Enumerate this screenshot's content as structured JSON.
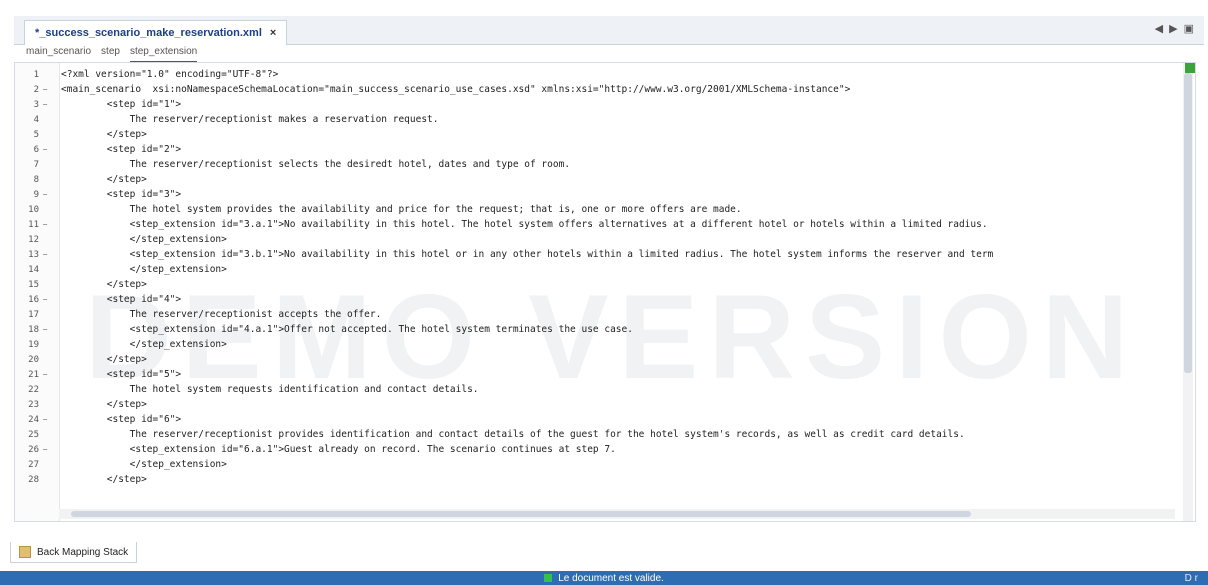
{
  "tab": {
    "title": "*_success_scenario_make_reservation.xml",
    "close": "×"
  },
  "tab_controls": [
    "◀",
    "▶",
    "▣"
  ],
  "breadcrumb": [
    "main_scenario",
    "step",
    "step_extension"
  ],
  "editor": {
    "lines": [
      {
        "n": "1",
        "code": "<?xml version=\"1.0\" encoding=\"UTF-8\"?>"
      },
      {
        "n": "2",
        "code": "<main_scenario  xsi:noNamespaceSchemaLocation=\"main_success_scenario_use_cases.xsd\" xmlns:xsi=\"http://www.w3.org/2001/XMLSchema-instance\">"
      },
      {
        "n": "3",
        "code": "        <step id=\"1\">"
      },
      {
        "n": "4",
        "code": "            The reserver/receptionist makes a reservation request."
      },
      {
        "n": "5",
        "code": "        </step>"
      },
      {
        "n": "6",
        "code": "        <step id=\"2\">"
      },
      {
        "n": "7",
        "code": "            The reserver/receptionist selects the desiredt hotel, dates and type of room."
      },
      {
        "n": "8",
        "code": "        </step>"
      },
      {
        "n": "9",
        "code": "        <step id=\"3\">"
      },
      {
        "n": "10",
        "code": "            The hotel system provides the availability and price for the request; that is, one or more offers are made."
      },
      {
        "n": "11",
        "code": "            <step_extension id=\"3.a.1\">No availability in this hotel. The hotel system offers alternatives at a different hotel or hotels within a limited radius."
      },
      {
        "n": "12",
        "code": "            </step_extension>"
      },
      {
        "n": "13",
        "code": "            <step_extension id=\"3.b.1\">No availability in this hotel or in any other hotels within a limited radius. The hotel system informs the reserver and term"
      },
      {
        "n": "14",
        "code": "            </step_extension>"
      },
      {
        "n": "15",
        "code": "        </step>"
      },
      {
        "n": "16",
        "code": "        <step id=\"4\">"
      },
      {
        "n": "17",
        "code": "            The reserver/receptionist accepts the offer."
      },
      {
        "n": "18",
        "code": "            <step_extension id=\"4.a.1\">Offer not accepted. The hotel system terminates the use case."
      },
      {
        "n": "19",
        "code": "            </step_extension>"
      },
      {
        "n": "20",
        "code": "        </step>"
      },
      {
        "n": "21",
        "code": "        <step id=\"5\">"
      },
      {
        "n": "22",
        "code": "            The hotel system requests identification and contact details."
      },
      {
        "n": "23",
        "code": "        </step>"
      },
      {
        "n": "24",
        "code": "        <step id=\"6\">"
      },
      {
        "n": "25",
        "code": "            The reserver/receptionist provides identification and contact details of the guest for the hotel system's records, as well as credit card details."
      },
      {
        "n": "26",
        "code": "            <step_extension id=\"6.a.1\">Guest already on record. The scenario continues at step 7."
      },
      {
        "n": "27",
        "code": "            </step_extension>"
      },
      {
        "n": "28",
        "code": "        </step>"
      }
    ]
  },
  "watermark": "DEMO VERSION",
  "bottom_tab": "Back Mapping Stack",
  "status": {
    "text": "Le document est valide.",
    "right": "D r"
  }
}
